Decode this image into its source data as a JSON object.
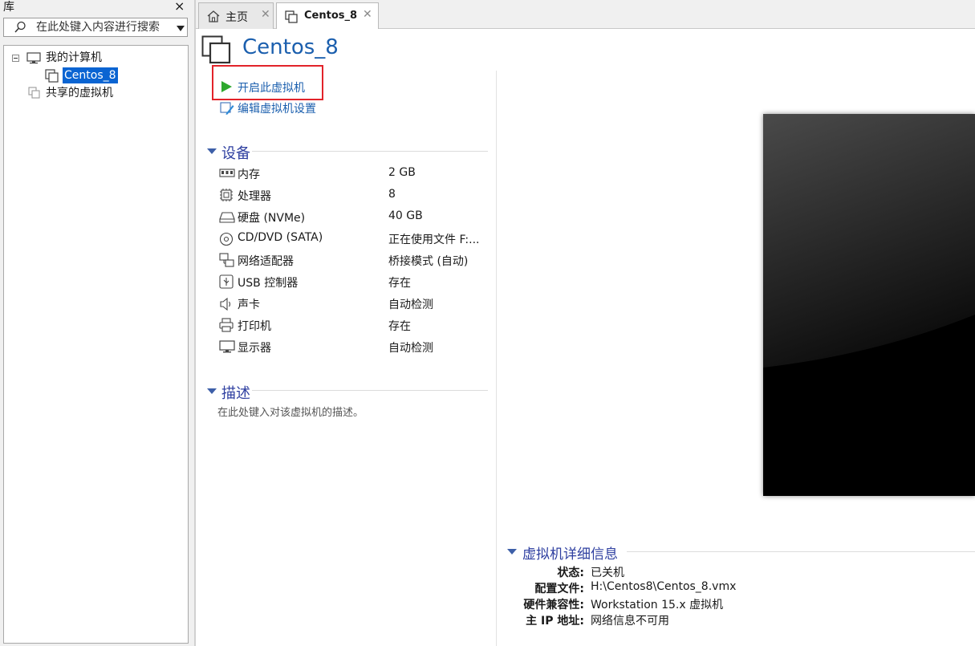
{
  "library": {
    "title": "库",
    "close": "×",
    "search_placeholder": "在此处键入内容进行搜索",
    "tree": [
      {
        "label": "我的计算机",
        "icon": "monitor-icon"
      },
      {
        "label": "Centos_8",
        "icon": "vm-icon",
        "selected": true
      },
      {
        "label": "共享的虚拟机",
        "icon": "shared-vm-icon"
      }
    ]
  },
  "tabs": [
    {
      "label": "主页",
      "icon": "home-icon",
      "close": "✕"
    },
    {
      "label": "Centos_8",
      "icon": "vm-icon",
      "close": "✕",
      "active": true
    }
  ],
  "vm": {
    "title": "Centos_8",
    "actions": {
      "power_on": "开启此虚拟机",
      "edit_settings": "编辑虚拟机设置"
    },
    "devices_header": "设备",
    "devices": [
      {
        "name": "内存",
        "value": "2 GB",
        "icon": "memory-icon"
      },
      {
        "name": "处理器",
        "value": "8",
        "icon": "cpu-icon"
      },
      {
        "name": "硬盘 (NVMe)",
        "value": "40 GB",
        "icon": "harddisk-icon"
      },
      {
        "name": "CD/DVD (SATA)",
        "value": "正在使用文件 F:...",
        "icon": "cd-icon"
      },
      {
        "name": "网络适配器",
        "value": "桥接模式 (自动)",
        "icon": "network-icon"
      },
      {
        "name": "USB 控制器",
        "value": "存在",
        "icon": "usb-icon"
      },
      {
        "name": "声卡",
        "value": "自动检测",
        "icon": "speaker-icon"
      },
      {
        "name": "打印机",
        "value": "存在",
        "icon": "printer-icon"
      },
      {
        "name": "显示器",
        "value": "自动检测",
        "icon": "display-icon"
      }
    ],
    "description_header": "描述",
    "description_placeholder": "在此处键入对该虚拟机的描述。",
    "details_header": "虚拟机详细信息",
    "details": [
      {
        "label": "状态:",
        "value": "已关机"
      },
      {
        "label": "配置文件:",
        "value": "H:\\Centos8\\Centos_8.vmx"
      },
      {
        "label": "硬件兼容性:",
        "value": "Workstation 15.x 虚拟机"
      },
      {
        "label": "主 IP 地址:",
        "value": "网络信息不可用"
      }
    ]
  },
  "colors": {
    "accent_blue": "#1b5fae",
    "section_blue": "#2e3fa0",
    "play_green": "#2ea82e",
    "highlight_red": "#e2232a",
    "selection_blue": "#0a64d2"
  }
}
